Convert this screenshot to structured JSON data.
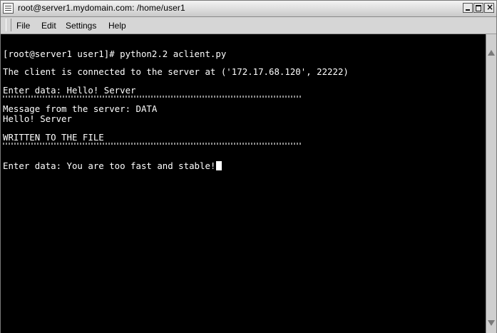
{
  "window": {
    "title": "root@server1.mydomain.com: /home/user1"
  },
  "menu": {
    "items": [
      "File",
      "Edit",
      "Settings",
      "Help"
    ]
  },
  "terminal": {
    "lines": [
      "[root@server1 user1]# python2.2 aclient.py",
      "The client is connected to the server at ('172.17.68.120', 22222)",
      "Enter data: Hello! Server",
      "Message from the server: DATA",
      "Hello! Server",
      "WRITTEN TO THE FILE",
      "Enter data: You are too fast and stable!"
    ]
  },
  "colors": {
    "terminal_background": "#000000",
    "terminal_text": "#ffffff"
  }
}
